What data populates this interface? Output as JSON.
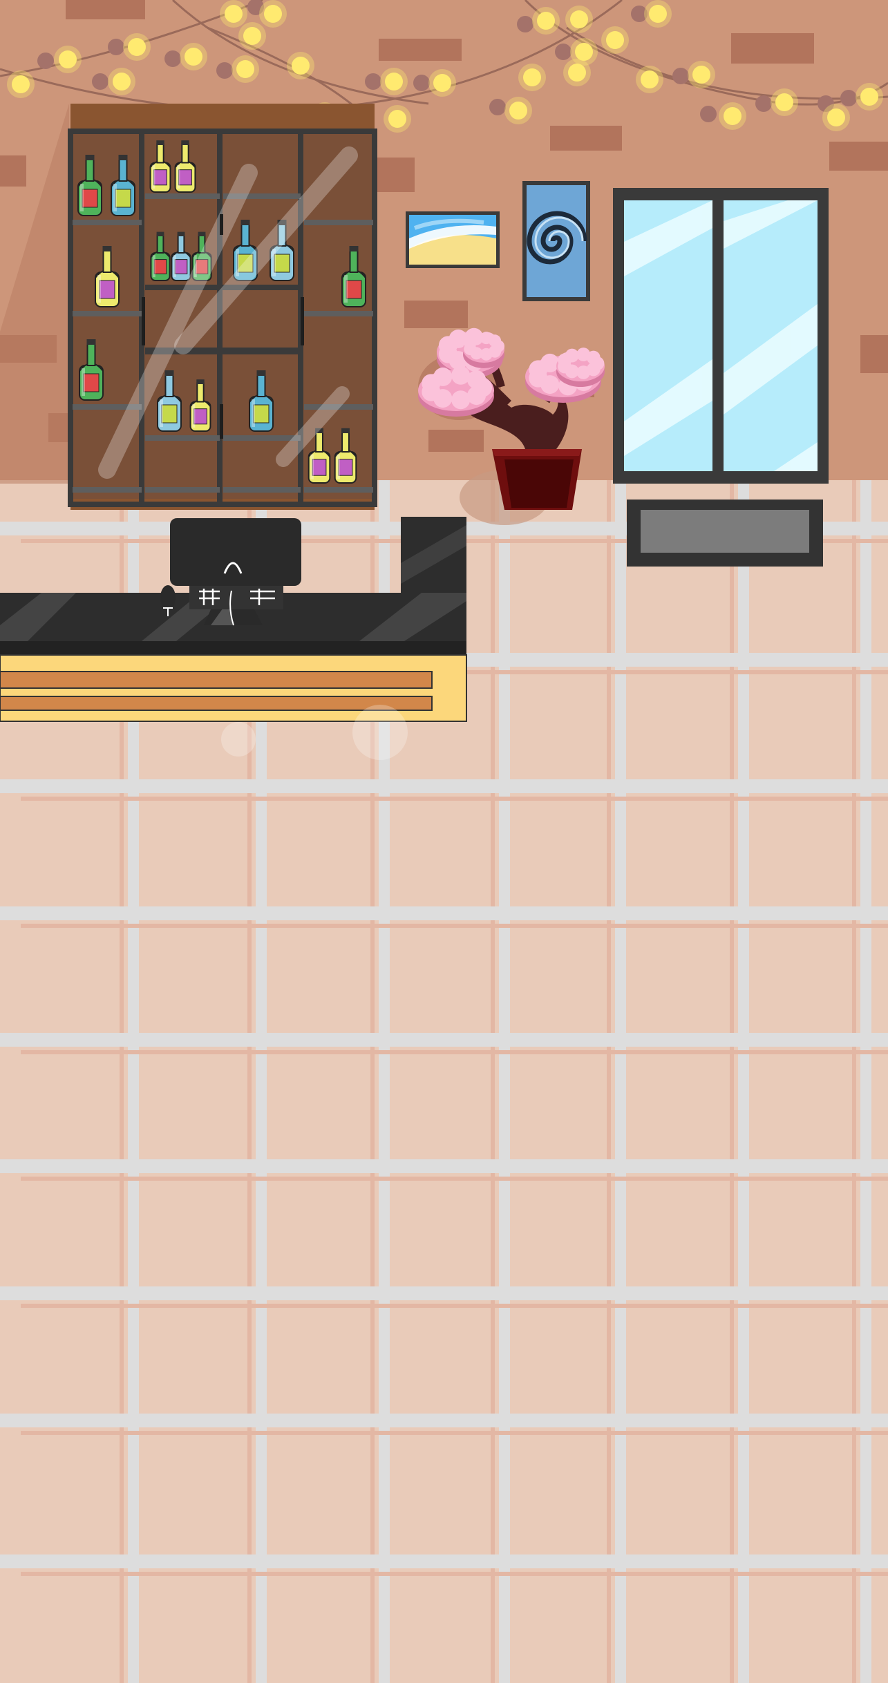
{
  "scene": {
    "name": "shop-interior",
    "palette": {
      "wall": "#CD967A",
      "wall_brick": "#B2745C",
      "floor": "#E9CBB9",
      "floor_line_light": "#DDDDDD",
      "floor_line_dark": "#E3B7A4",
      "cabinet_wood": "#7A5038",
      "cabinet_top": "#8A5530",
      "cabinet_frame": "#3A3A3A",
      "counter_top": "#2D2D2D",
      "counter_front": "#FCD77B",
      "counter_drawer": "#D2874A",
      "window_glass": "#B6ECFB",
      "window_frame": "#3A3A3A",
      "pot": "#6E0E0E",
      "blossom": "#F4A3C4",
      "bulb": "#FFEA70",
      "bulb_off": "#A4726A"
    },
    "bottles": [
      {
        "color": "#4FB35B",
        "label": "#E04848"
      },
      {
        "color": "#5AB3D1",
        "label": "#C5D94A"
      },
      {
        "color": "#EDEA6D",
        "label": "#C05FC4"
      },
      {
        "color": "#EDEA6D",
        "label": "#C05FC4"
      },
      {
        "color": "#EDEA6D",
        "label": "#C05FC4"
      },
      {
        "color": "#4FB35B",
        "label": "#E04848"
      },
      {
        "color": "#8FC9E0",
        "label": "#C05FC4"
      },
      {
        "color": "#4FB35B",
        "label": "#E04848"
      },
      {
        "color": "#5AB3D1",
        "label": "#C5D94A"
      },
      {
        "color": "#8FC9E0",
        "label": "#C5D94A"
      },
      {
        "color": "#4FB35B",
        "label": "#E04848"
      },
      {
        "color": "#4FB35B",
        "label": "#E04848"
      },
      {
        "color": "#8FC9E0",
        "label": "#C5D94A"
      },
      {
        "color": "#EDEA6D",
        "label": "#C05FC4"
      },
      {
        "color": "#5AB3D1",
        "label": "#C5D94A"
      },
      {
        "color": "#EDEA6D",
        "label": "#C05FC4"
      },
      {
        "color": "#EDEA6D",
        "label": "#C05FC4"
      }
    ],
    "icons": [
      "string-lights-icon",
      "bottle-icon",
      "blossom-icon",
      "swirl-painting-icon",
      "beach-painting-icon",
      "cash-register-icon",
      "microphone-icon"
    ]
  }
}
